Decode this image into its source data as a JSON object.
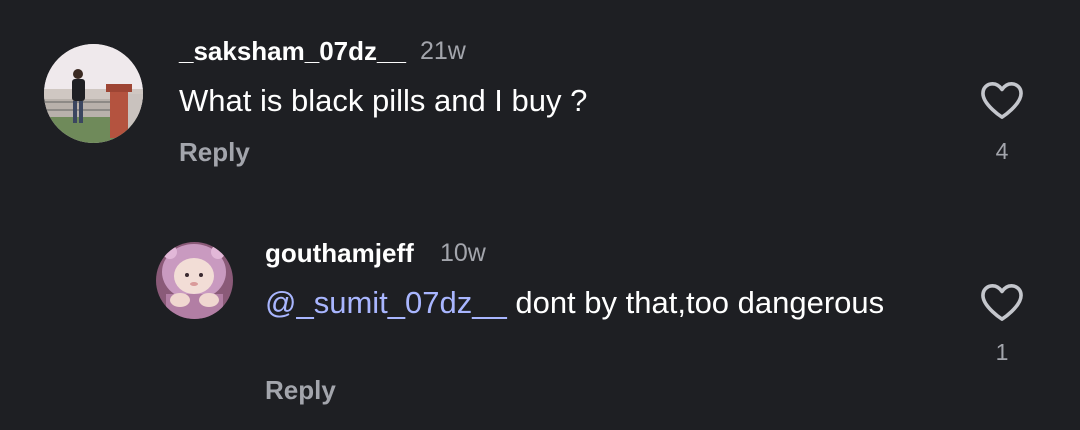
{
  "comments": [
    {
      "username": "_saksham_07dz__",
      "time": "21w",
      "text": "What is black pills and I buy ?",
      "reply_label": "Reply",
      "likes": "4",
      "like_icon": "heart-outline-icon"
    },
    {
      "username": "gouthamjeff",
      "time": "10w",
      "mention": "@_sumit_07dz__",
      "text": " dont by that,too dangerous",
      "reply_label": "Reply",
      "likes": "1",
      "like_icon": "heart-outline-icon"
    }
  ],
  "colors": {
    "background": "#1e1f23",
    "mention": "#a9b6ff",
    "muted": "#a3a5ac"
  }
}
